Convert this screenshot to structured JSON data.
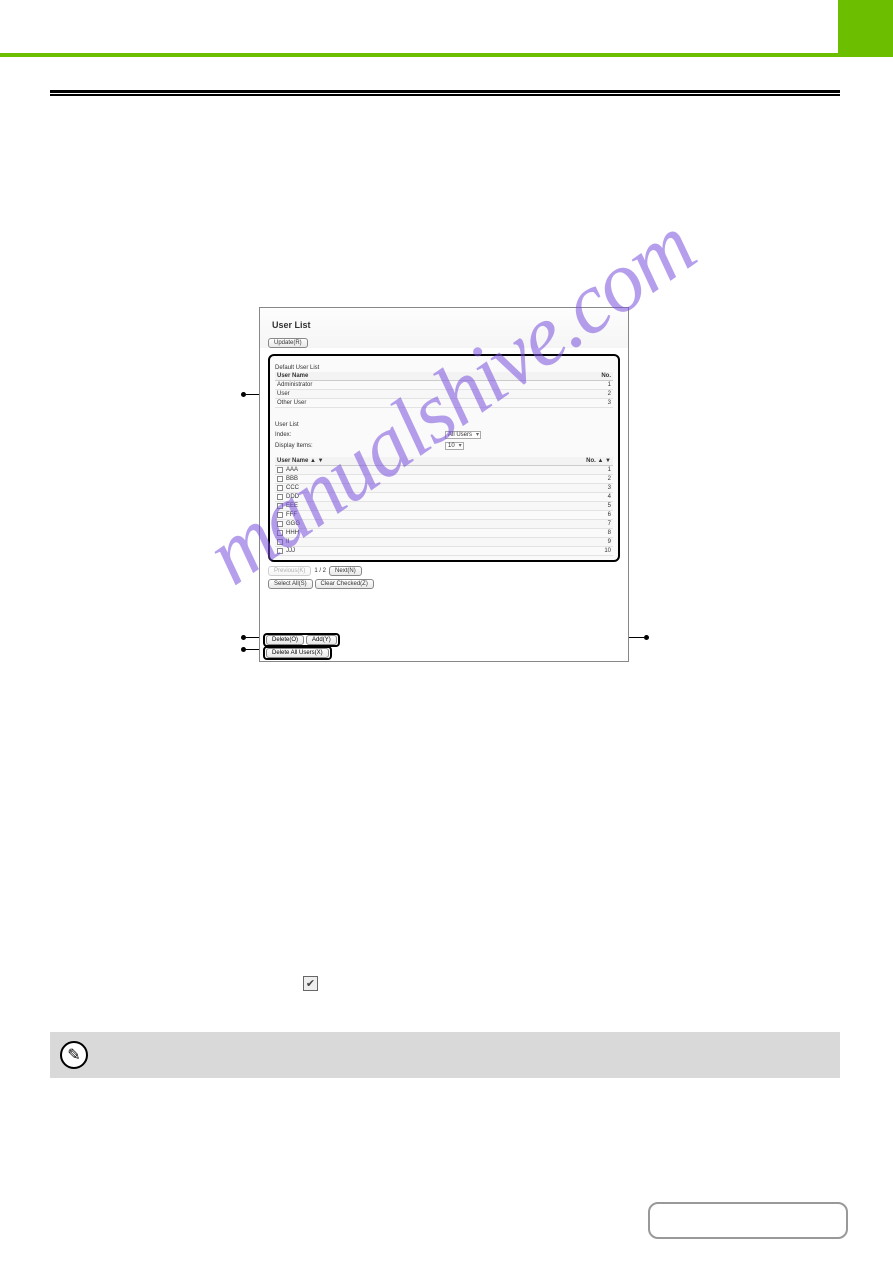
{
  "watermark": "manualshive.com",
  "panel": {
    "title": "User List",
    "update_btn": "Update(R)",
    "default_header": "Default User List",
    "col_user": "User Name",
    "col_no": "No.",
    "defaults": [
      {
        "name": "Administrator",
        "no": "1"
      },
      {
        "name": "User",
        "no": "2"
      },
      {
        "name": "Other User",
        "no": "3"
      }
    ],
    "userlist_header": "User List",
    "index_label": "Index:",
    "index_value": "All Users",
    "display_label": "Display Items:",
    "display_value": "10",
    "sort_user": "User Name  ▲  ▼",
    "sort_no": "No.  ▲  ▼",
    "rows": [
      {
        "name": "AAA",
        "no": "1"
      },
      {
        "name": "BBB",
        "no": "2"
      },
      {
        "name": "CCC",
        "no": "3"
      },
      {
        "name": "DDD",
        "no": "4"
      },
      {
        "name": "EEE",
        "no": "5"
      },
      {
        "name": "FFF",
        "no": "6"
      },
      {
        "name": "GGG",
        "no": "7"
      },
      {
        "name": "HHH",
        "no": "8"
      },
      {
        "name": "II",
        "no": "9"
      },
      {
        "name": "JJJ",
        "no": "10"
      }
    ],
    "prev_btn": "Previous(K)",
    "page_indicator": "1 / 2",
    "next_btn": "Next(N)",
    "select_all_btn": "Select All(S)",
    "clear_checked_btn": "Clear Checked(Z)",
    "delete_btn": "Delete(O)",
    "add_btn": "Add(Y)",
    "delete_all_btn": "Delete All Users(X)"
  }
}
